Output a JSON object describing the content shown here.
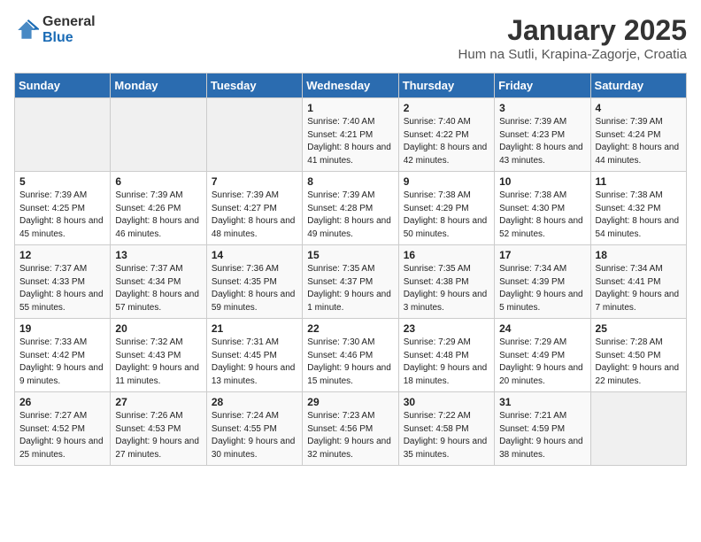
{
  "header": {
    "logo_general": "General",
    "logo_blue": "Blue",
    "title": "January 2025",
    "subtitle": "Hum na Sutli, Krapina-Zagorje, Croatia"
  },
  "days_of_week": [
    "Sunday",
    "Monday",
    "Tuesday",
    "Wednesday",
    "Thursday",
    "Friday",
    "Saturday"
  ],
  "weeks": [
    [
      {
        "day": "",
        "info": ""
      },
      {
        "day": "",
        "info": ""
      },
      {
        "day": "",
        "info": ""
      },
      {
        "day": "1",
        "info": "Sunrise: 7:40 AM\nSunset: 4:21 PM\nDaylight: 8 hours and 41 minutes."
      },
      {
        "day": "2",
        "info": "Sunrise: 7:40 AM\nSunset: 4:22 PM\nDaylight: 8 hours and 42 minutes."
      },
      {
        "day": "3",
        "info": "Sunrise: 7:39 AM\nSunset: 4:23 PM\nDaylight: 8 hours and 43 minutes."
      },
      {
        "day": "4",
        "info": "Sunrise: 7:39 AM\nSunset: 4:24 PM\nDaylight: 8 hours and 44 minutes."
      }
    ],
    [
      {
        "day": "5",
        "info": "Sunrise: 7:39 AM\nSunset: 4:25 PM\nDaylight: 8 hours and 45 minutes."
      },
      {
        "day": "6",
        "info": "Sunrise: 7:39 AM\nSunset: 4:26 PM\nDaylight: 8 hours and 46 minutes."
      },
      {
        "day": "7",
        "info": "Sunrise: 7:39 AM\nSunset: 4:27 PM\nDaylight: 8 hours and 48 minutes."
      },
      {
        "day": "8",
        "info": "Sunrise: 7:39 AM\nSunset: 4:28 PM\nDaylight: 8 hours and 49 minutes."
      },
      {
        "day": "9",
        "info": "Sunrise: 7:38 AM\nSunset: 4:29 PM\nDaylight: 8 hours and 50 minutes."
      },
      {
        "day": "10",
        "info": "Sunrise: 7:38 AM\nSunset: 4:30 PM\nDaylight: 8 hours and 52 minutes."
      },
      {
        "day": "11",
        "info": "Sunrise: 7:38 AM\nSunset: 4:32 PM\nDaylight: 8 hours and 54 minutes."
      }
    ],
    [
      {
        "day": "12",
        "info": "Sunrise: 7:37 AM\nSunset: 4:33 PM\nDaylight: 8 hours and 55 minutes."
      },
      {
        "day": "13",
        "info": "Sunrise: 7:37 AM\nSunset: 4:34 PM\nDaylight: 8 hours and 57 minutes."
      },
      {
        "day": "14",
        "info": "Sunrise: 7:36 AM\nSunset: 4:35 PM\nDaylight: 8 hours and 59 minutes."
      },
      {
        "day": "15",
        "info": "Sunrise: 7:35 AM\nSunset: 4:37 PM\nDaylight: 9 hours and 1 minute."
      },
      {
        "day": "16",
        "info": "Sunrise: 7:35 AM\nSunset: 4:38 PM\nDaylight: 9 hours and 3 minutes."
      },
      {
        "day": "17",
        "info": "Sunrise: 7:34 AM\nSunset: 4:39 PM\nDaylight: 9 hours and 5 minutes."
      },
      {
        "day": "18",
        "info": "Sunrise: 7:34 AM\nSunset: 4:41 PM\nDaylight: 9 hours and 7 minutes."
      }
    ],
    [
      {
        "day": "19",
        "info": "Sunrise: 7:33 AM\nSunset: 4:42 PM\nDaylight: 9 hours and 9 minutes."
      },
      {
        "day": "20",
        "info": "Sunrise: 7:32 AM\nSunset: 4:43 PM\nDaylight: 9 hours and 11 minutes."
      },
      {
        "day": "21",
        "info": "Sunrise: 7:31 AM\nSunset: 4:45 PM\nDaylight: 9 hours and 13 minutes."
      },
      {
        "day": "22",
        "info": "Sunrise: 7:30 AM\nSunset: 4:46 PM\nDaylight: 9 hours and 15 minutes."
      },
      {
        "day": "23",
        "info": "Sunrise: 7:29 AM\nSunset: 4:48 PM\nDaylight: 9 hours and 18 minutes."
      },
      {
        "day": "24",
        "info": "Sunrise: 7:29 AM\nSunset: 4:49 PM\nDaylight: 9 hours and 20 minutes."
      },
      {
        "day": "25",
        "info": "Sunrise: 7:28 AM\nSunset: 4:50 PM\nDaylight: 9 hours and 22 minutes."
      }
    ],
    [
      {
        "day": "26",
        "info": "Sunrise: 7:27 AM\nSunset: 4:52 PM\nDaylight: 9 hours and 25 minutes."
      },
      {
        "day": "27",
        "info": "Sunrise: 7:26 AM\nSunset: 4:53 PM\nDaylight: 9 hours and 27 minutes."
      },
      {
        "day": "28",
        "info": "Sunrise: 7:24 AM\nSunset: 4:55 PM\nDaylight: 9 hours and 30 minutes."
      },
      {
        "day": "29",
        "info": "Sunrise: 7:23 AM\nSunset: 4:56 PM\nDaylight: 9 hours and 32 minutes."
      },
      {
        "day": "30",
        "info": "Sunrise: 7:22 AM\nSunset: 4:58 PM\nDaylight: 9 hours and 35 minutes."
      },
      {
        "day": "31",
        "info": "Sunrise: 7:21 AM\nSunset: 4:59 PM\nDaylight: 9 hours and 38 minutes."
      },
      {
        "day": "",
        "info": ""
      }
    ]
  ]
}
